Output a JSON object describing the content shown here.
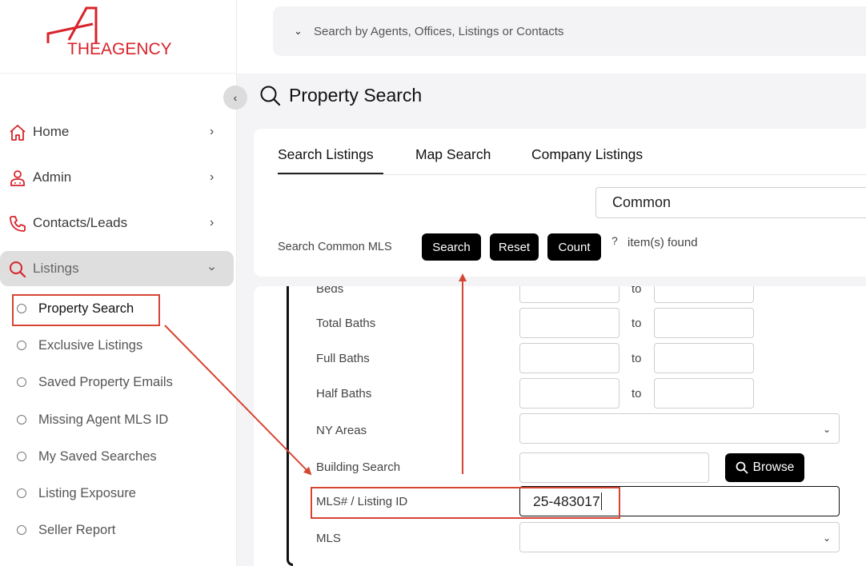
{
  "brand": {
    "logo_text": "THEAGENCY"
  },
  "topbar": {
    "search_placeholder": "Search by Agents, Offices, Listings or Contacts"
  },
  "sidebar": {
    "items": [
      {
        "label": "Home",
        "icon": "home-icon"
      },
      {
        "label": "Admin",
        "icon": "admin-icon"
      },
      {
        "label": "Contacts/Leads",
        "icon": "phone-icon"
      },
      {
        "label": "Listings",
        "icon": "search-icon"
      }
    ],
    "subitems": [
      {
        "label": "Property Search"
      },
      {
        "label": "Exclusive Listings"
      },
      {
        "label": "Saved Property Emails"
      },
      {
        "label": "Missing Agent MLS ID"
      },
      {
        "label": "My Saved Searches"
      },
      {
        "label": "Listing Exposure"
      },
      {
        "label": "Seller Report"
      }
    ]
  },
  "page": {
    "title": "Property Search"
  },
  "tabs": [
    {
      "label": "Search Listings"
    },
    {
      "label": "Map Search"
    },
    {
      "label": "Company Listings"
    }
  ],
  "search_panel": {
    "mls_select": "Common",
    "label": "Search Common MLS",
    "search_btn": "Search",
    "reset_btn": "Reset",
    "count_btn": "Count",
    "count_value": "?",
    "found_text": "item(s) found"
  },
  "form": {
    "beds_label": "Beds",
    "total_baths_label": "Total Baths",
    "full_baths_label": "Full Baths",
    "half_baths_label": "Half Baths",
    "ny_areas_label": "NY Areas",
    "building_search_label": "Building Search",
    "browse_btn": "Browse",
    "mls_id_label": "MLS# / Listing ID",
    "mls_id_value": "25-483017",
    "mls_label": "MLS",
    "to_text": "to"
  },
  "colors": {
    "brand_red": "#d8232a",
    "annotation_red": "#d64532"
  }
}
